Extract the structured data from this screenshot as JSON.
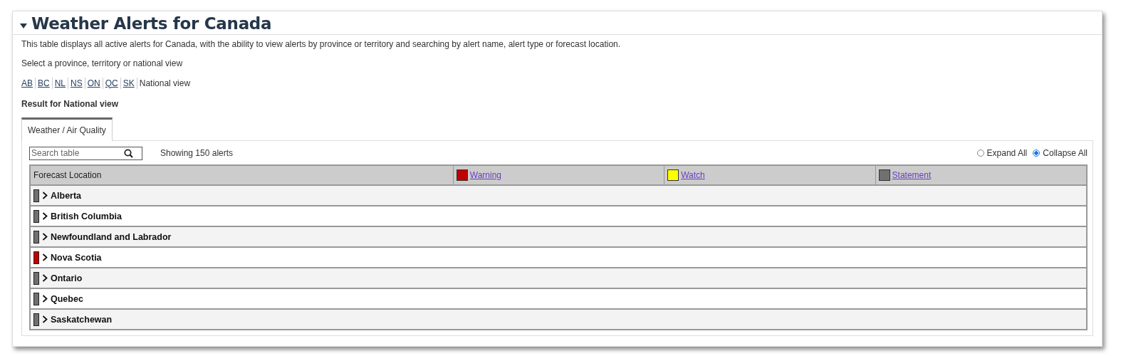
{
  "section": {
    "title": "Weather Alerts for Canada",
    "expanded": true
  },
  "description": "This table displays all active alerts for Canada, with the ability to view alerts by province or territory and searching by alert name, alert type or forecast location.",
  "view_prompt": "Select a province, territory or national view",
  "views": [
    {
      "label": "AB",
      "selected": false
    },
    {
      "label": "BC",
      "selected": false
    },
    {
      "label": "NL",
      "selected": false
    },
    {
      "label": "NS",
      "selected": false
    },
    {
      "label": "ON",
      "selected": false
    },
    {
      "label": "QC",
      "selected": false
    },
    {
      "label": "SK",
      "selected": false
    },
    {
      "label": "National view",
      "selected": true
    }
  ],
  "result_heading": "Result for National view",
  "tabs": [
    {
      "label": "Weather / Air Quality",
      "selected": true
    }
  ],
  "search": {
    "placeholder": "Search table"
  },
  "count": "Showing 150 alerts",
  "display_options": [
    {
      "label": "Expand All",
      "selected": false
    },
    {
      "label": "Collapse All",
      "selected": true
    }
  ],
  "table": {
    "columns": [
      {
        "label": "Forecast Location"
      },
      {
        "label": "Warning",
        "color": "#c00000"
      },
      {
        "label": "Watch",
        "color": "#ffff00"
      },
      {
        "label": "Statement",
        "color": "#707070"
      }
    ],
    "rows": [
      {
        "name": "Alberta",
        "color": "#707070",
        "expanded": false
      },
      {
        "name": "British Columbia",
        "color": "#707070",
        "expanded": false
      },
      {
        "name": "Newfoundland and Labrador",
        "color": "#707070",
        "expanded": false
      },
      {
        "name": "Nova Scotia",
        "color": "#c00000",
        "expanded": false
      },
      {
        "name": "Ontario",
        "color": "#707070",
        "expanded": false
      },
      {
        "name": "Quebec",
        "color": "#707070",
        "expanded": false
      },
      {
        "name": "Saskatchewan",
        "color": "#707070",
        "expanded": false
      }
    ]
  }
}
